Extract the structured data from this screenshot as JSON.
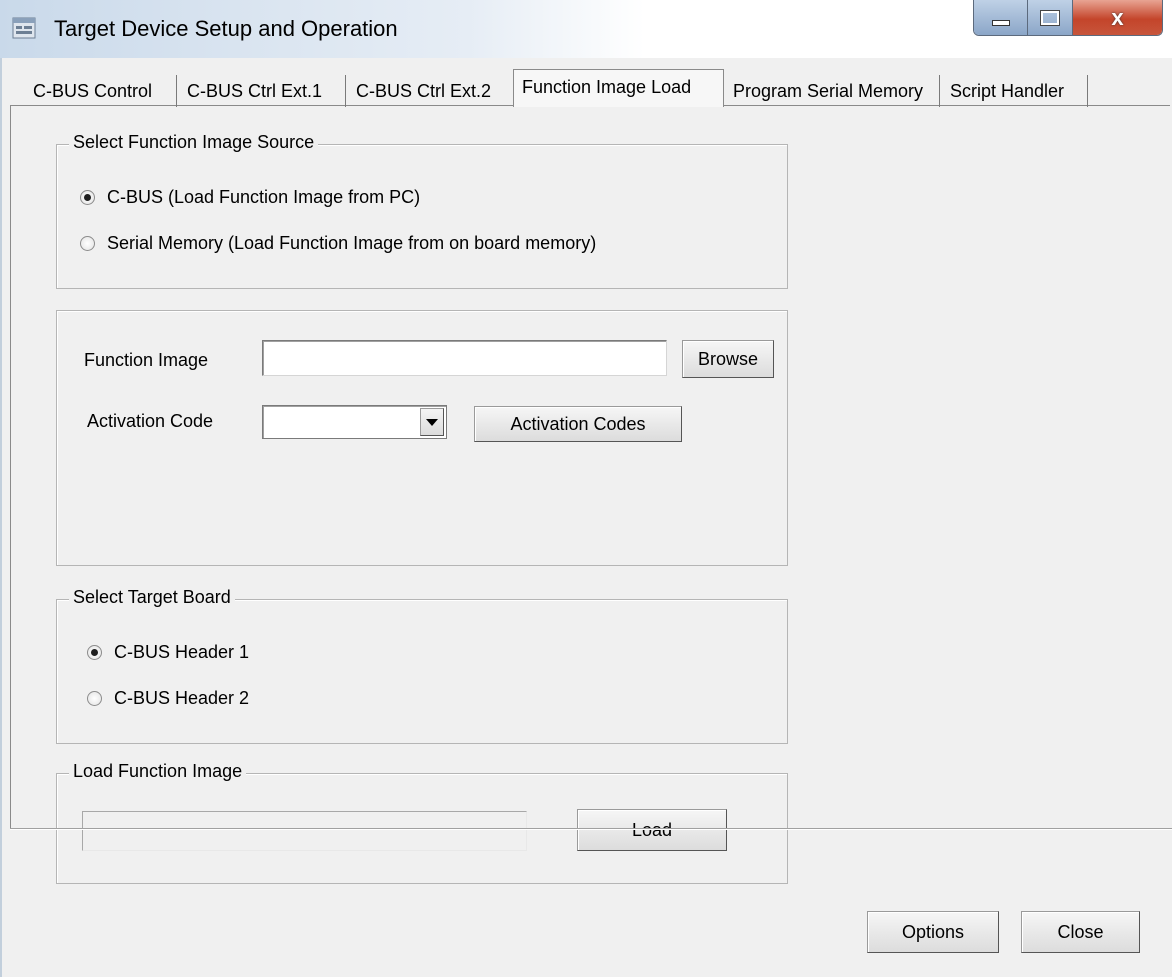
{
  "window": {
    "title": "Target Device Setup and Operation",
    "icon": "app-window-icon",
    "controls": {
      "minimize": "minimize-icon",
      "maximize": "maximize-icon",
      "close": "x"
    }
  },
  "tabs": [
    {
      "label": "C-BUS Control"
    },
    {
      "label": "C-BUS Ctrl Ext.1"
    },
    {
      "label": "C-BUS Ctrl Ext.2"
    },
    {
      "label": "Function Image Load",
      "active": true
    },
    {
      "label": "Program Serial Memory"
    },
    {
      "label": "Script Handler"
    }
  ],
  "source_group": {
    "legend": "Select Function Image Source",
    "options": [
      {
        "label": "C-BUS (Load Function Image from PC)",
        "checked": true
      },
      {
        "label": "Serial Memory (Load Function Image from on board memory)",
        "checked": false
      }
    ]
  },
  "image_group": {
    "function_image_label": "Function Image",
    "function_image_value": "",
    "browse_label": "Browse",
    "activation_code_label": "Activation Code",
    "activation_code_value": "",
    "activation_codes_label": "Activation Codes"
  },
  "target_group": {
    "legend": "Select Target Board",
    "options": [
      {
        "label": "C-BUS Header 1",
        "checked": true
      },
      {
        "label": "C-BUS Header 2",
        "checked": false
      }
    ]
  },
  "load_group": {
    "legend": "Load Function Image",
    "progress": 0,
    "load_label": "Load"
  },
  "footer": {
    "options_label": "Options",
    "close_label": "Close"
  }
}
